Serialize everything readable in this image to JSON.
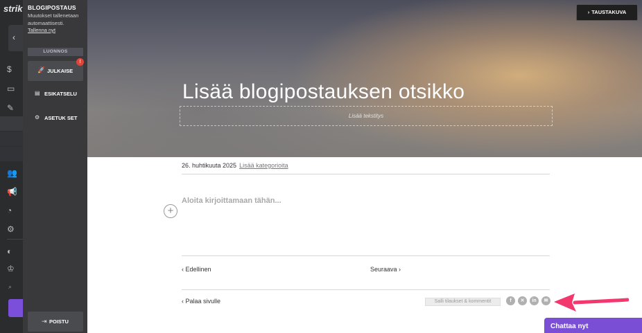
{
  "app_sidebar": {
    "logo": "strik"
  },
  "editor": {
    "title": "BLOGIPOSTAUS",
    "save_note": "Muutokset tallenetaan automaattisesti.",
    "save_now": "Tallenna nyt",
    "status": "LUONNOS",
    "publish_label": "JULKAISE",
    "alert": "!",
    "preview_label": "ESIKATSELU",
    "settings_label": "ASETUK SET",
    "logout_label": "POISTU"
  },
  "hero": {
    "background_button": "TAUSTAKUVA",
    "title": "Lisää blogipostauksen otsikko",
    "subtitle_placeholder": "Lisää tekstitys"
  },
  "post": {
    "date": "26. huhtikuuta 2025",
    "add_categories": "Lisää kategorioita",
    "body_placeholder": "Aloita kirjoittamaan tähän...",
    "previous": "Edellinen",
    "next": "Seuraava",
    "back_to_page": "Palaa sivulle",
    "allow_comments": "Salli tilaukset & kommentit",
    "share_icons": [
      "facebook-icon",
      "x-icon",
      "linkedin-icon",
      "email-icon"
    ]
  },
  "chat": {
    "label": "Chattaa nyt"
  },
  "colors": {
    "accent": "#7a4fd6",
    "annotation_arrow": "#f2386e",
    "alert": "#e0453c"
  }
}
